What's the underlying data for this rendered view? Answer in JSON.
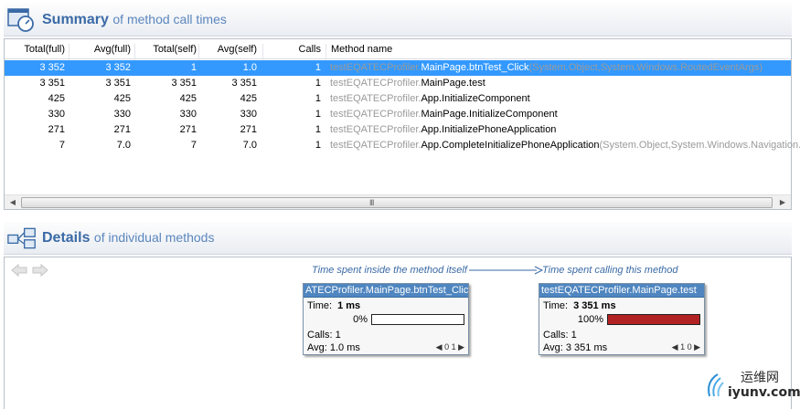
{
  "summary": {
    "title_bold": "Summary",
    "title_rest": "of method call times",
    "columns": [
      "Total(full)",
      "Avg(full)",
      "Total(self)",
      "Avg(self)",
      "Calls",
      "Method name"
    ],
    "rows": [
      {
        "total_full": "3 352",
        "avg_full": "3 352",
        "total_self": "1",
        "avg_self": "1.0",
        "calls": "1",
        "ns": "testEQATECProfiler.",
        "method": "MainPage.btnTest_Click",
        "sig": "(System.Object,System.Windows.RoutedEventArgs)",
        "selected": true
      },
      {
        "total_full": "3 351",
        "avg_full": "3 351",
        "total_self": "3 351",
        "avg_self": "3 351",
        "calls": "1",
        "ns": "testEQATECProfiler.",
        "method": "MainPage.test",
        "sig": ""
      },
      {
        "total_full": "425",
        "avg_full": "425",
        "total_self": "425",
        "avg_self": "425",
        "calls": "1",
        "ns": "testEQATECProfiler.",
        "method": "App.InitializeComponent",
        "sig": ""
      },
      {
        "total_full": "330",
        "avg_full": "330",
        "total_self": "330",
        "avg_self": "330",
        "calls": "1",
        "ns": "testEQATECProfiler.",
        "method": "MainPage.InitializeComponent",
        "sig": ""
      },
      {
        "total_full": "271",
        "avg_full": "271",
        "total_self": "271",
        "avg_self": "271",
        "calls": "1",
        "ns": "testEQATECProfiler.",
        "method": "App.InitializePhoneApplication",
        "sig": ""
      },
      {
        "total_full": "7",
        "avg_full": "7.0",
        "total_self": "7",
        "avg_self": "7.0",
        "calls": "1",
        "ns": "testEQATECProfiler.",
        "method": "App.CompleteInitializePhoneApplication",
        "sig": "(System.Object,System.Windows.Navigation.Na"
      }
    ],
    "scroll_grip": "III"
  },
  "details": {
    "title_bold": "Details",
    "title_rest": "of individual methods",
    "label_inside": "Time spent inside the method itself",
    "label_calling": "Time spent calling this method",
    "cards": [
      {
        "title": "ATECProfiler.MainPage.btnTest_Click",
        "time_label": "Time:",
        "time_value": "1 ms",
        "percent": "0%",
        "fill": 0,
        "calls_label": "Calls:",
        "calls_value": "1",
        "avg_label": "Avg:",
        "avg_value": "1.0 ms",
        "pager": "0 1"
      },
      {
        "title": "testEQATECProfiler.MainPage.test",
        "time_label": "Time:",
        "time_value": "3 351 ms",
        "percent": "100%",
        "fill": 1,
        "calls_label": "Calls:",
        "calls_value": "1",
        "avg_label": "Avg:",
        "avg_value": "3 351 ms",
        "pager": "1 0"
      }
    ]
  },
  "watermark": {
    "cn": "运维网",
    "url": "iyunv.com"
  },
  "colors": {
    "accent": "#3a6aa6",
    "selection": "#3399ff",
    "card_title": "#4f86c0",
    "bar_fill": "#b22222"
  }
}
